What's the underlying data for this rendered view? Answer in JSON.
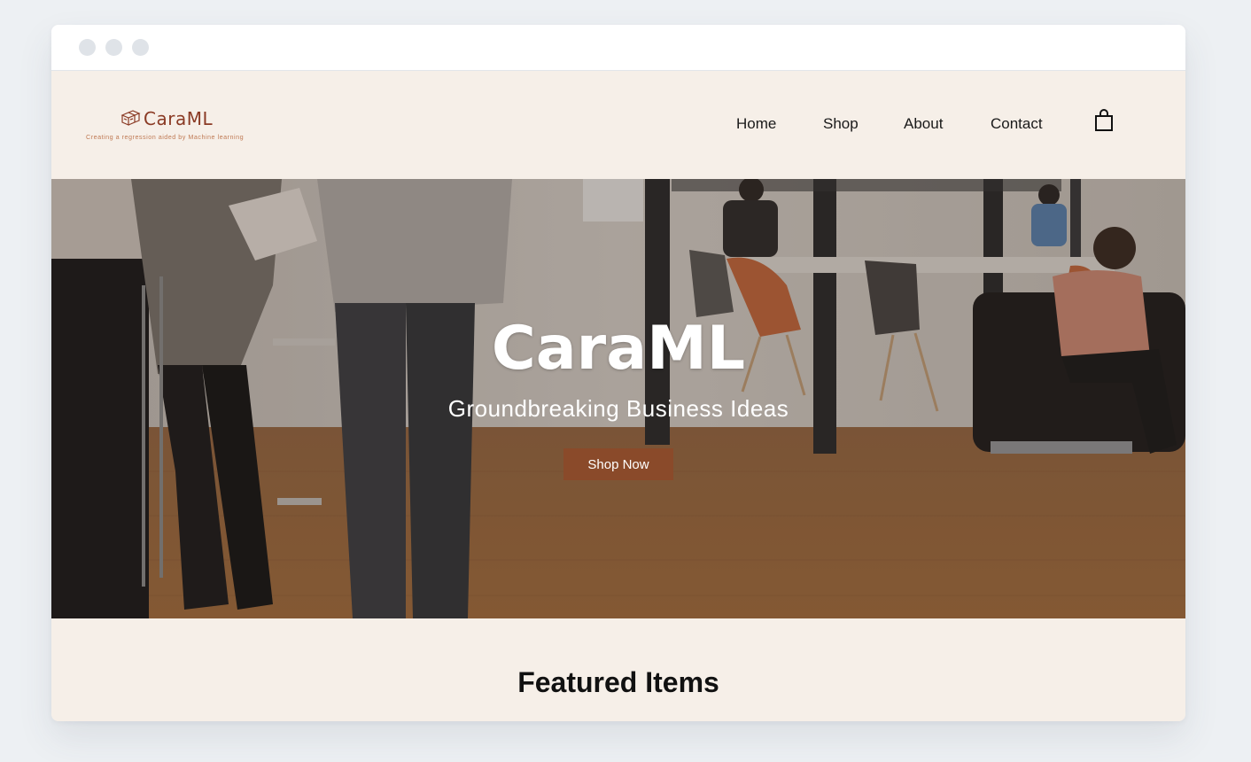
{
  "window": {
    "controls": [
      "close",
      "minimize",
      "maximize"
    ]
  },
  "header": {
    "logo_text": "CaraML",
    "logo_tagline": "Creating a regression aided by Machine learning",
    "nav": {
      "home": "Home",
      "shop": "Shop",
      "about": "About",
      "contact": "Contact"
    },
    "cart_icon": "shopping-bag-icon"
  },
  "hero": {
    "title": "CaraML",
    "subtitle": "Groundbreaking Business Ideas",
    "cta_label": "Shop Now"
  },
  "featured": {
    "title": "Featured Items"
  },
  "colors": {
    "page_bg": "#f6efe8",
    "brand": "#8a3a24",
    "button": "#8a4a2a"
  }
}
